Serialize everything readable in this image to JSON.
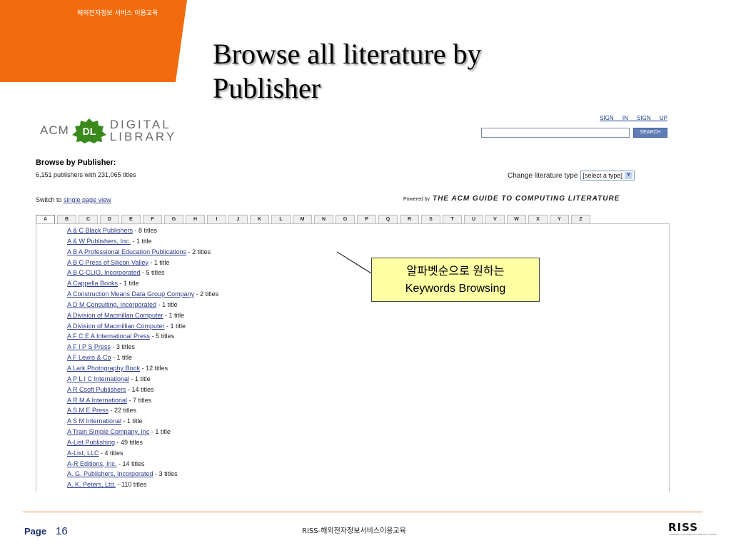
{
  "slide": {
    "header_text": "해외전자정보 서비스 이용교육",
    "title_line1": "Browse all literature by",
    "title_line2": "Publisher"
  },
  "acm": {
    "logo_acm": "ACM",
    "logo_dl": "DL",
    "logo_digital": "DIGITAL",
    "logo_library": "LIBRARY",
    "sign_in": "SIGN IN",
    "sign_up": "SIGN UP",
    "search_button": "SEARCH",
    "browse_heading": "Browse by Publisher:",
    "count_text": "6,151 publishers with 231,065 titles",
    "change_type_label": "Change literature type",
    "change_type_value": "[select a type]",
    "switch_label": "Switch to",
    "switch_link": "single page view",
    "powered_by": "Powered by",
    "guide_name": "THE ACM GUIDE TO COMPUTING LITERATURE"
  },
  "letters": [
    "A",
    "B",
    "C",
    "D",
    "E",
    "F",
    "G",
    "H",
    "I",
    "J",
    "K",
    "L",
    "M",
    "N",
    "O",
    "P",
    "Q",
    "R",
    "S",
    "T",
    "U",
    "V",
    "W",
    "X",
    "Y",
    "Z"
  ],
  "active_letter": "A",
  "publishers": [
    {
      "name": "A & C Black Publishers",
      "count": " - 8 titles"
    },
    {
      "name": "A & W Publishers, Inc.",
      "count": " - 1 title"
    },
    {
      "name": "A B A Professional Education Publications",
      "count": " - 2 titles"
    },
    {
      "name": "A B C Press of Silicon Valley",
      "count": " - 1 title"
    },
    {
      "name": "A B C-CLIO, Incorporated",
      "count": " - 5 titles"
    },
    {
      "name": "A Cappella Books",
      "count": " - 1 title"
    },
    {
      "name": "A Construction Means Data Group Company",
      "count": " - 2 titles"
    },
    {
      "name": "A D M Consulting, Incorporated",
      "count": " - 1 title"
    },
    {
      "name": "A Division of Macmillan Computer",
      "count": " - 1 title"
    },
    {
      "name": "A Division of Macmillian Computer",
      "count": " - 1 title"
    },
    {
      "name": "A F C E A International Press",
      "count": " - 5 titles"
    },
    {
      "name": "A F I P S Press",
      "count": " - 3 titles"
    },
    {
      "name": "A F Lewis & Co",
      "count": " - 1 title"
    },
    {
      "name": "A Lark Photography Book",
      "count": " - 12 titles"
    },
    {
      "name": "A P L I C International",
      "count": " - 1 title"
    },
    {
      "name": "A R Csoft Publishers",
      "count": " - 14 titles"
    },
    {
      "name": "A R M A International",
      "count": " - 7 titles"
    },
    {
      "name": "A S M E Press",
      "count": " - 22 titles"
    },
    {
      "name": "A S M International",
      "count": " - 1 title"
    },
    {
      "name": "A Train Simple Company, Inc",
      "count": " - 1 title"
    },
    {
      "name": "A-List Publishing",
      "count": " - 49 titles"
    },
    {
      "name": "A-List, LLC",
      "count": " - 4 titles"
    },
    {
      "name": "A-R Editions, Inc.",
      "count": " - 14 titles"
    },
    {
      "name": "A. G. Publishers, Incorporated",
      "count": " - 3 titles"
    },
    {
      "name": "A. K. Peters, Ltd.",
      "count": " - 110 titles"
    }
  ],
  "callout": {
    "line1": "알파벳순으로 원하는",
    "line2": "Keywords Browsing"
  },
  "footer": {
    "page_label": "Page",
    "page_number": "16",
    "center_text": "RISS-해외전자정보서비스이용교육",
    "logo_text": "RISS",
    "logo_sub": "RESEARCH INFORMATION SERVICE SYSTEM"
  },
  "colors": {
    "orange": "#f26c0d",
    "link": "#2b3c8c",
    "callout_bg": "#ffffa3",
    "dl_green": "#3c8a1e"
  }
}
